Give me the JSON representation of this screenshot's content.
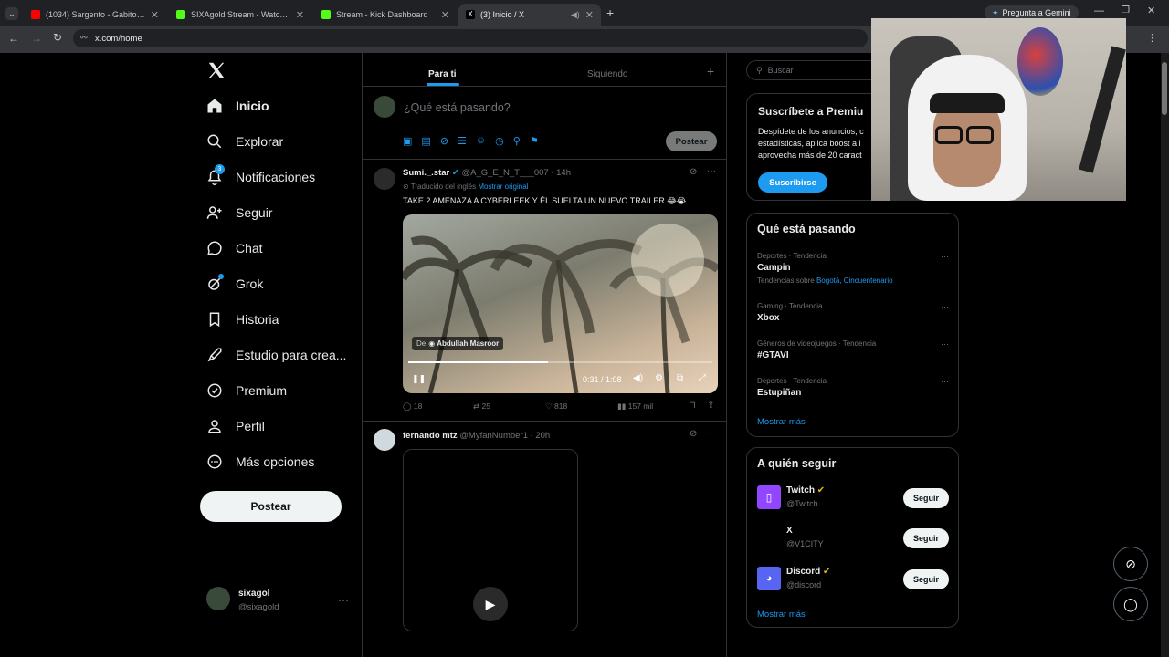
{
  "browser": {
    "tabs": [
      {
        "title": "(1034) Sargento - Gabito Ballest",
        "favicon_color": "#ff0000"
      },
      {
        "title": "SIXAgold Stream - Watch Live o",
        "favicon_color": "#53fc18"
      },
      {
        "title": "Stream - Kick Dashboard",
        "favicon_color": "#53fc18"
      },
      {
        "title": "(3) Inicio / X",
        "favicon_color": "#ffffff"
      }
    ],
    "gemini_label": "Pregunta a Gemini",
    "url": "x.com/home"
  },
  "nav": {
    "items": [
      {
        "label": "Inicio",
        "icon": "home-icon"
      },
      {
        "label": "Explorar",
        "icon": "search-icon"
      },
      {
        "label": "Notificaciones",
        "icon": "bell-icon",
        "badge": "3"
      },
      {
        "label": "Seguir",
        "icon": "follow-icon"
      },
      {
        "label": "Chat",
        "icon": "chat-icon"
      },
      {
        "label": "Grok",
        "icon": "grok-icon"
      },
      {
        "label": "Historia",
        "icon": "bookmark-icon"
      },
      {
        "label": "Estudio para crea...",
        "icon": "rocket-icon"
      },
      {
        "label": "Premium",
        "icon": "verified-icon"
      },
      {
        "label": "Perfil",
        "icon": "person-icon"
      },
      {
        "label": "Más opciones",
        "icon": "more-circle-icon"
      }
    ],
    "post_button": "Postear",
    "account": {
      "name": "sixagol",
      "handle": "@sixagold"
    }
  },
  "feed": {
    "tabs": [
      "Para ti",
      "Siguiendo"
    ],
    "composer_placeholder": "¿Qué está pasando?",
    "composer_post": "Postear",
    "posts": [
      {
        "name": "Sumi._.star",
        "handle": "@A_G_E_N_T___007",
        "time": "· 14h",
        "translated": "Traducido del inglés",
        "show_original": "Mostrar original",
        "text": "TAKE 2 AMENAZA A CYBERLEEK Y ÉL SUELTA UN NUEVO TRAILER 😂😭",
        "video": {
          "from_prefix": "De",
          "from_name": "Abdullah Masroor",
          "time": "0:31 / 1:08",
          "progress": 0.46
        },
        "replies": "18",
        "reposts": "25",
        "likes": "818",
        "views": "157 mil"
      },
      {
        "name": "fernando mtz",
        "handle": "@MyfanNumber1",
        "time": "· 20h"
      }
    ]
  },
  "right": {
    "search_placeholder": "Buscar",
    "premium": {
      "title": "Suscríbete a Premiu",
      "body_lines": [
        "Despídete de los anuncios, c",
        "estadísticas, aplica boost a l",
        "aprovecha más de 20 caract"
      ],
      "button": "Suscribirse"
    },
    "trends_title": "Qué está pasando",
    "trends": [
      {
        "meta": "Deportes · Tendencia",
        "name": "Campin",
        "related_prefix": "Tendencias sobre",
        "related": "Bogotá, Cincuentenario"
      },
      {
        "meta": "Gaming · Tendencia",
        "name": "Xbox"
      },
      {
        "meta": "Géneros de videojuegos · Tendencia",
        "name": "#GTAVI"
      },
      {
        "meta": "Deportes · Tendencia",
        "name": "Estupiñan"
      }
    ],
    "show_more": "Mostrar más",
    "who_title": "A quién seguir",
    "who": [
      {
        "name": "Twitch",
        "handle": "@Twitch",
        "button": "Seguir",
        "color": "#9146ff"
      },
      {
        "name": "X",
        "handle": "@V1CITY",
        "button": "Seguir",
        "color": "#000000"
      },
      {
        "name": "Discord",
        "handle": "@discord",
        "button": "Seguir",
        "color": "#5865f2"
      }
    ],
    "who_more": "Mostrar más"
  }
}
